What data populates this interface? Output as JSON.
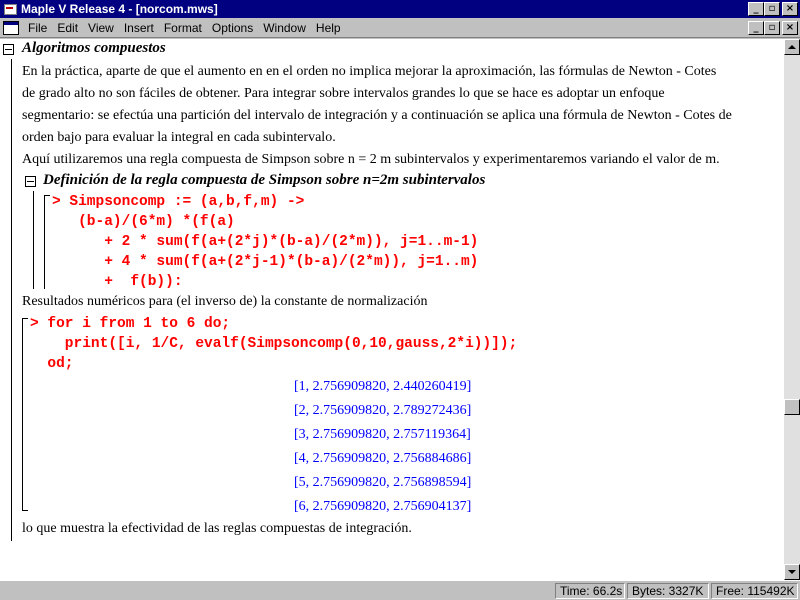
{
  "window": {
    "title": "Maple V Release 4 - [norcom.mws]",
    "minimize": "_",
    "restore": "▫",
    "close": "×"
  },
  "menu": {
    "items": [
      "File",
      "Edit",
      "View",
      "Insert",
      "Format",
      "Options",
      "Window",
      "Help"
    ]
  },
  "doc": {
    "section_title": "Algoritmos compuestos",
    "intro": [
      "En la práctica, aparte de que el aumento en en el orden no implica mejorar la aproximación,  las fórmulas de Newton - Cotes",
      "de grado alto no son fáciles de obtener. Para integrar sobre intervalos grandes lo que se hace es adoptar un enfoque",
      "segmentario: se efectúa una partición del intervalo de integración y a continuación se aplica una fórmula de Newton - Cotes de",
      "orden bajo para evaluar la integral en cada subintervalo."
    ],
    "intro2": "Aquí utilizaremos una regla compuesta de Simpson sobre n = 2 m subintervalos y experimentaremos variando el valor de m.",
    "subsection_title": "Definición de la regla compuesta de Simpson sobre n=2m subintervalos",
    "code1": [
      "> Simpsoncomp := (a,b,f,m) ->",
      "   (b-a)/(6*m) *(f(a)",
      "      + 2 * sum(f(a+(2*j)*(b-a)/(2*m)), j=1..m-1)",
      "      + 4 * sum(f(a+(2*j-1)*(b-a)/(2*m)), j=1..m)",
      "      +  f(b)):"
    ],
    "results_label": "Resultados numéricos para (el inverso de) la constante de normalización",
    "code2": [
      "> for i from 1 to 6 do;",
      "    print([i, 1/C, evalf(Simpsoncomp(0,10,gauss,2*i))]);",
      "  od;"
    ],
    "outputs": [
      "[1, 2.756909820, 2.440260419]",
      "[2, 2.756909820, 2.789272436]",
      "[3, 2.756909820, 2.757119364]",
      "[4, 2.756909820, 2.756884686]",
      "[5, 2.756909820, 2.756898594]",
      "[6, 2.756909820, 2.756904137]"
    ],
    "conclusion": "lo que muestra la efectividad de las reglas compuestas de integración."
  },
  "status": {
    "time": "Time:  66.2s",
    "bytes": "Bytes:  3327K",
    "free": "Free:  115492K"
  }
}
